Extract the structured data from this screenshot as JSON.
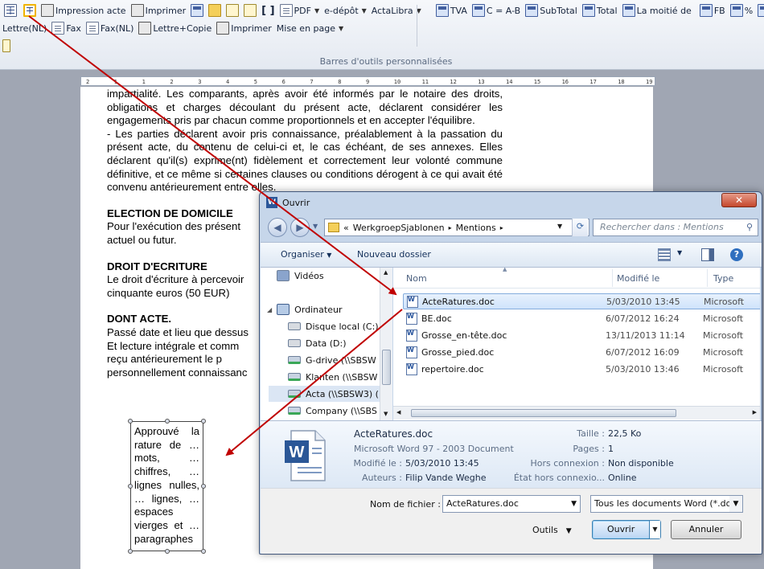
{
  "ribbon": {
    "row1": {
      "impression_acte": "Impression acte",
      "imprimer": "Imprimer",
      "brackets": "[ ]",
      "pdf": "PDF",
      "e_depot": "e-dépôt",
      "actalibra": "ActaLibra",
      "tva": "TVA",
      "c_ab": "C = A-B",
      "subtotal": "SubTotal",
      "total": "Total",
      "moitie": "La moitié de",
      "fb": "FB",
      "percent": "%",
      "fr": "Fr"
    },
    "row2": {
      "lettre_nl": "Lettre(NL)",
      "fax": "Fax",
      "fax_nl": "Fax(NL)",
      "lettre_copie": "Lettre+Copie",
      "imprimer": "Imprimer",
      "mise_en_page": "Mise en page"
    },
    "group_label": "Barres d'outils personnalisées"
  },
  "ruler": {
    "ticks": [
      "2",
      "1",
      "1",
      "2",
      "3",
      "4",
      "5",
      "6",
      "7",
      "8",
      "9",
      "10",
      "11",
      "12",
      "13",
      "14",
      "15",
      "16",
      "17",
      "18",
      "19"
    ]
  },
  "document": {
    "para1": "impartialité. Les comparants, après avoir été informés par le notaire des droits, obligations et charges découlant du présent acte, déclarent considérer les engagements pris par chacun comme proportionnels et en accepter l'équilibre.",
    "para2": "- Les parties déclarent avoir pris connaissance, préalablement à la passation du présent acte, du contenu de celui-ci et, le cas échéant, de ses annexes. Elles déclarent qu'il(s) exprime(nt) fidèlement et correctement leur volonté commune définitive, et ce même si certaines clauses ou conditions dérogent à ce qui avait été convenu antérieurement entre elles.",
    "head_election": "ELECTION DE DOMICILE",
    "election_text": "Pour l'exécution des présent",
    "election_text2": "actuel ou futur.",
    "head_droit": "DROIT D'ECRITURE",
    "droit_text": "Le droit d'écriture à percevoir",
    "droit_text2": "cinquante euros (50 EUR)",
    "head_dont": "DONT ACTE.",
    "dont_line1": "Passé date et lieu que dessus",
    "dont_line2": "Et lecture intégrale et comm",
    "dont_line3": "reçu antérieurement le p",
    "dont_line4": "personnellement connaissanc",
    "side_box": "Approuvé la rature de … mots, … chiffres, … lignes nulles, … lignes, … espaces vierges et … paragraphes"
  },
  "dialog": {
    "title": "Ouvrir",
    "close": "✕",
    "breadcrumb": [
      "«",
      "WerkgroepSjablonen",
      "▸",
      "Mentions",
      "▸"
    ],
    "search_placeholder": "Rechercher dans : Mentions",
    "toolbar": {
      "organiser": "Organiser",
      "nouveau_dossier": "Nouveau dossier"
    },
    "nav": [
      {
        "label": "Vidéos"
      },
      {
        "label": "Ordinateur"
      },
      {
        "label": "Disque local (C:)"
      },
      {
        "label": "Data (D:)"
      },
      {
        "label": "G-drive (\\\\SBSW"
      },
      {
        "label": "Klanten (\\\\SBSW"
      },
      {
        "label": "Acta (\\\\SBSW3) ("
      },
      {
        "label": "Company (\\\\SBS"
      }
    ],
    "columns": {
      "name": "Nom",
      "modified": "Modifié le",
      "type": "Type"
    },
    "files": [
      {
        "name": "ActeRatures.doc",
        "modified": "5/03/2010 13:45",
        "type": "Microsoft"
      },
      {
        "name": "BE.doc",
        "modified": "6/07/2012 16:24",
        "type": "Microsoft"
      },
      {
        "name": "Grosse_en-tête.doc",
        "modified": "13/11/2013 11:14",
        "type": "Microsoft"
      },
      {
        "name": "Grosse_pied.doc",
        "modified": "6/07/2012 16:09",
        "type": "Microsoft"
      },
      {
        "name": "repertoire.doc",
        "modified": "5/03/2010 13:46",
        "type": "Microsoft"
      }
    ],
    "details": {
      "filename": "ActeRatures.doc",
      "doctype": "Microsoft Word 97 - 2003 Document",
      "modified_label": "Modifié le :",
      "modified_value": "5/03/2010 13:45",
      "authors_label": "Auteurs :",
      "authors_value": "Filip Vande Weghe",
      "size_label": "Taille :",
      "size_value": "22,5 Ko",
      "pages_label": "Pages :",
      "pages_value": "1",
      "offline_label": "Hors connexion :",
      "offline_value": "Non disponible",
      "offline_state_label": "État hors connexio...",
      "offline_state_value": "Online"
    },
    "filename_label": "Nom de fichier :",
    "filename_value": "ActeRatures.doc",
    "filetype_value": "Tous les documents Word (*.do",
    "tools_label": "Outils",
    "open_label": "Ouvrir",
    "cancel_label": "Annuler"
  },
  "colors": {
    "arrow": "#c00000",
    "dialog_bg": "#c6d6ea",
    "selection": "#cfe3fb"
  }
}
